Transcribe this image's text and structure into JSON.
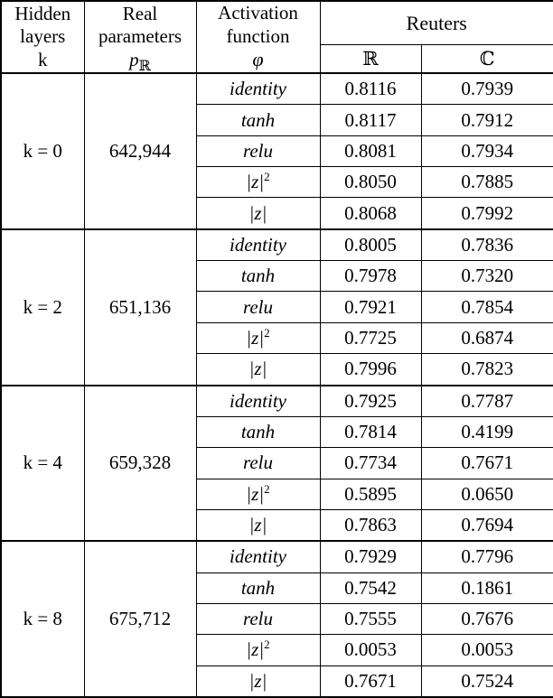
{
  "table": {
    "headers": {
      "hidden_layers": "Hidden layers",
      "hidden_layers_sym": "k",
      "real_parameters": "Real parameters",
      "real_parameters_sym_base": "p",
      "real_parameters_sym_sub": "ℝ",
      "activation_function": "Activation function",
      "activation_function_sym": "φ",
      "dataset": "Reuters",
      "sub_real": "ℝ",
      "sub_complex": "ℂ"
    },
    "activations": [
      "identity",
      "tanh",
      "relu",
      "|z|²",
      "|z|"
    ],
    "blocks": [
      {
        "k_label": "k = 0",
        "params": "642,944",
        "rows": [
          {
            "activation": "identity",
            "real": "0.8116",
            "complex": "0.7939"
          },
          {
            "activation": "tanh",
            "real": "0.8117",
            "complex": "0.7912"
          },
          {
            "activation": "relu",
            "real": "0.8081",
            "complex": "0.7934"
          },
          {
            "activation": "|z|^2",
            "real": "0.8050",
            "complex": "0.7885"
          },
          {
            "activation": "|z|",
            "real": "0.8068",
            "complex": "0.7992"
          }
        ]
      },
      {
        "k_label": "k = 2",
        "params": "651,136",
        "rows": [
          {
            "activation": "identity",
            "real": "0.8005",
            "complex": "0.7836"
          },
          {
            "activation": "tanh",
            "real": "0.7978",
            "complex": "0.7320"
          },
          {
            "activation": "relu",
            "real": "0.7921",
            "complex": "0.7854"
          },
          {
            "activation": "|z|^2",
            "real": "0.7725",
            "complex": "0.6874"
          },
          {
            "activation": "|z|",
            "real": "0.7996",
            "complex": "0.7823"
          }
        ]
      },
      {
        "k_label": "k = 4",
        "params": "659,328",
        "rows": [
          {
            "activation": "identity",
            "real": "0.7925",
            "complex": "0.7787"
          },
          {
            "activation": "tanh",
            "real": "0.7814",
            "complex": "0.4199"
          },
          {
            "activation": "relu",
            "real": "0.7734",
            "complex": "0.7671"
          },
          {
            "activation": "|z|^2",
            "real": "0.5895",
            "complex": "0.0650"
          },
          {
            "activation": "|z|",
            "real": "0.7863",
            "complex": "0.7694"
          }
        ]
      },
      {
        "k_label": "k = 8",
        "params": "675,712",
        "rows": [
          {
            "activation": "identity",
            "real": "0.7929",
            "complex": "0.7796"
          },
          {
            "activation": "tanh",
            "real": "0.7542",
            "complex": "0.1861"
          },
          {
            "activation": "relu",
            "real": "0.7555",
            "complex": "0.7676"
          },
          {
            "activation": "|z|^2",
            "real": "0.0053",
            "complex": "0.0053"
          },
          {
            "activation": "|z|",
            "real": "0.7671",
            "complex": "0.7524"
          }
        ]
      }
    ]
  },
  "colors": {
    "background": "#ffffff",
    "border": "#000000",
    "text": "#000000"
  }
}
